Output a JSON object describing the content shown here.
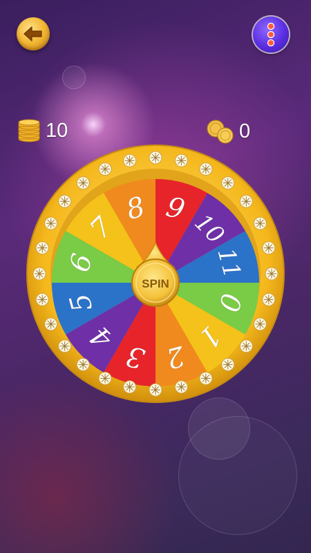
{
  "balance": {
    "coins": "10",
    "tokens": "0"
  },
  "wheel": {
    "center_label": "SPIN",
    "segments": [
      {
        "label": "1",
        "color": "#F4C21A"
      },
      {
        "label": "0",
        "color": "#7ACB46"
      },
      {
        "label": "11",
        "color": "#2B72C9"
      },
      {
        "label": "10",
        "color": "#6E2FA7"
      },
      {
        "label": "9",
        "color": "#E6242A"
      },
      {
        "label": "8",
        "color": "#F08A1E"
      },
      {
        "label": "7",
        "color": "#F4C21A"
      },
      {
        "label": "6",
        "color": "#7ACB46"
      },
      {
        "label": "5",
        "color": "#2B72C9"
      },
      {
        "label": "4",
        "color": "#6E2FA7"
      },
      {
        "label": "3",
        "color": "#E6242A"
      },
      {
        "label": "2",
        "color": "#F08A1E"
      }
    ],
    "rim_color": "#F5B81C",
    "hub_color": "#F3C23A"
  },
  "icons": {
    "back": "back-arrow-icon",
    "menu": "more-vertical-icon",
    "coins": "coin-stack-icon",
    "tokens": "token-coins-icon"
  }
}
